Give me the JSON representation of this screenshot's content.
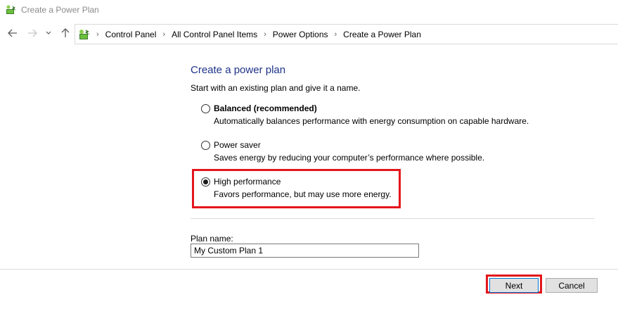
{
  "window": {
    "title": "Create a Power Plan",
    "icon": "power-options-icon"
  },
  "nav": {
    "back_icon": "back-arrow-icon",
    "forward_icon": "forward-arrow-icon",
    "recent_icon": "chevron-down-icon",
    "up_icon": "up-arrow-icon",
    "breadcrumbs": [
      {
        "label": "Control Panel"
      },
      {
        "label": "All Control Panel Items"
      },
      {
        "label": "Power Options"
      },
      {
        "label": "Create a Power Plan"
      }
    ]
  },
  "main": {
    "heading": "Create a power plan",
    "intro": "Start with an existing plan and give it a name.",
    "options": [
      {
        "label": "Balanced (recommended)",
        "description": "Automatically balances performance with energy consumption on capable hardware.",
        "selected": false
      },
      {
        "label": "Power saver",
        "description": "Saves energy by reducing your computer’s performance where possible.",
        "selected": false
      },
      {
        "label": "High performance",
        "description": "Favors performance, but may use more energy.",
        "selected": true
      }
    ],
    "plan_name_label": "Plan name:",
    "plan_name_value": "My Custom Plan 1"
  },
  "buttons": {
    "next": "Next",
    "cancel": "Cancel"
  },
  "colors": {
    "heading": "#1e3287",
    "highlight": "#e3161c",
    "title_text": "#8a8a8a"
  }
}
